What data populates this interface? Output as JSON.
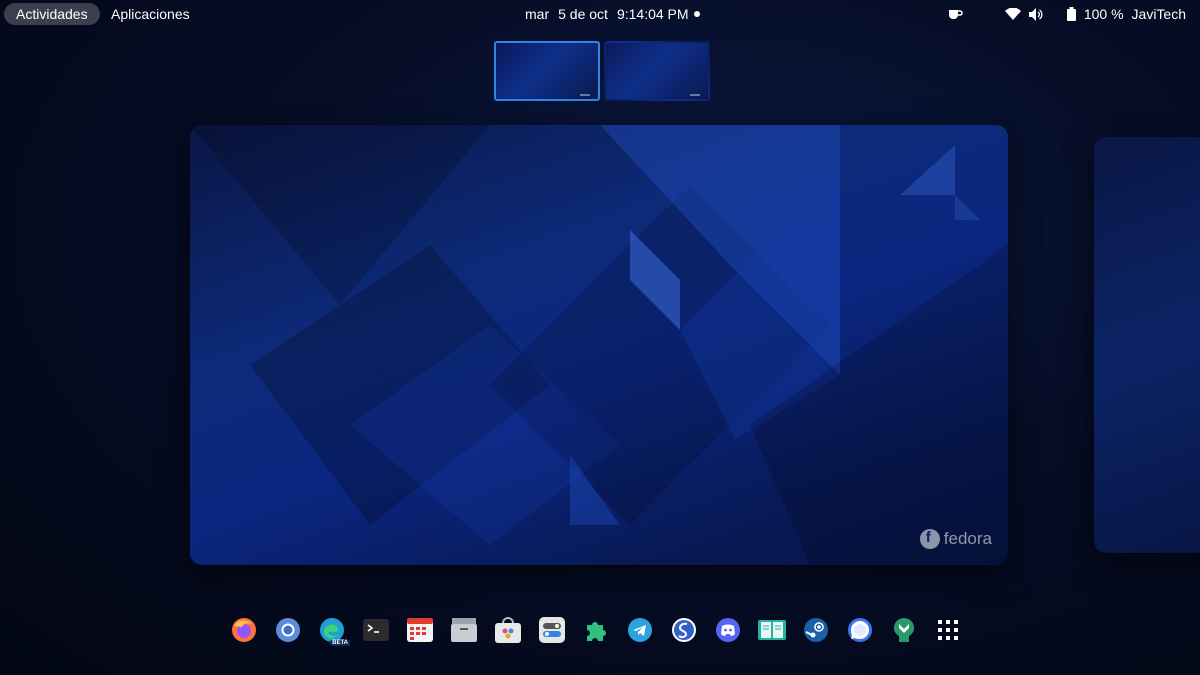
{
  "topbar": {
    "activities_label": "Actividades",
    "applications_label": "Aplicaciones",
    "clock": {
      "day": "mar",
      "date": "5 de oct",
      "time": "9:14:04 PM"
    },
    "battery": "100 %",
    "user": "JaviTech"
  },
  "workspace": {
    "watermark": "fedora"
  },
  "dash": {
    "apps": [
      {
        "name": "Firefox",
        "icon": "firefox-icon"
      },
      {
        "name": "Chromium",
        "icon": "chromium-icon"
      },
      {
        "name": "Microsoft Edge Beta",
        "icon": "edge-beta-icon",
        "badge": "BETA"
      },
      {
        "name": "Terminal",
        "icon": "terminal-icon"
      },
      {
        "name": "Calendar",
        "icon": "calendar-icon"
      },
      {
        "name": "Files",
        "icon": "files-icon"
      },
      {
        "name": "Software",
        "icon": "software-icon"
      },
      {
        "name": "Settings",
        "icon": "settings-icon"
      },
      {
        "name": "Extensions",
        "icon": "extensions-icon"
      },
      {
        "name": "Telegram",
        "icon": "telegram-icon"
      },
      {
        "name": "Simplenote",
        "icon": "simplenote-icon"
      },
      {
        "name": "Discord",
        "icon": "discord-icon"
      },
      {
        "name": "Foliate",
        "icon": "foliate-icon"
      },
      {
        "name": "Steam",
        "icon": "steam-icon"
      },
      {
        "name": "Signal",
        "icon": "signal-icon"
      },
      {
        "name": "Tweaks",
        "icon": "tweaks-icon"
      },
      {
        "name": "Show Applications",
        "icon": "app-grid-icon"
      }
    ]
  },
  "colors": {
    "accent": "#3584e4",
    "wallpaper": "#0d2a7a"
  }
}
